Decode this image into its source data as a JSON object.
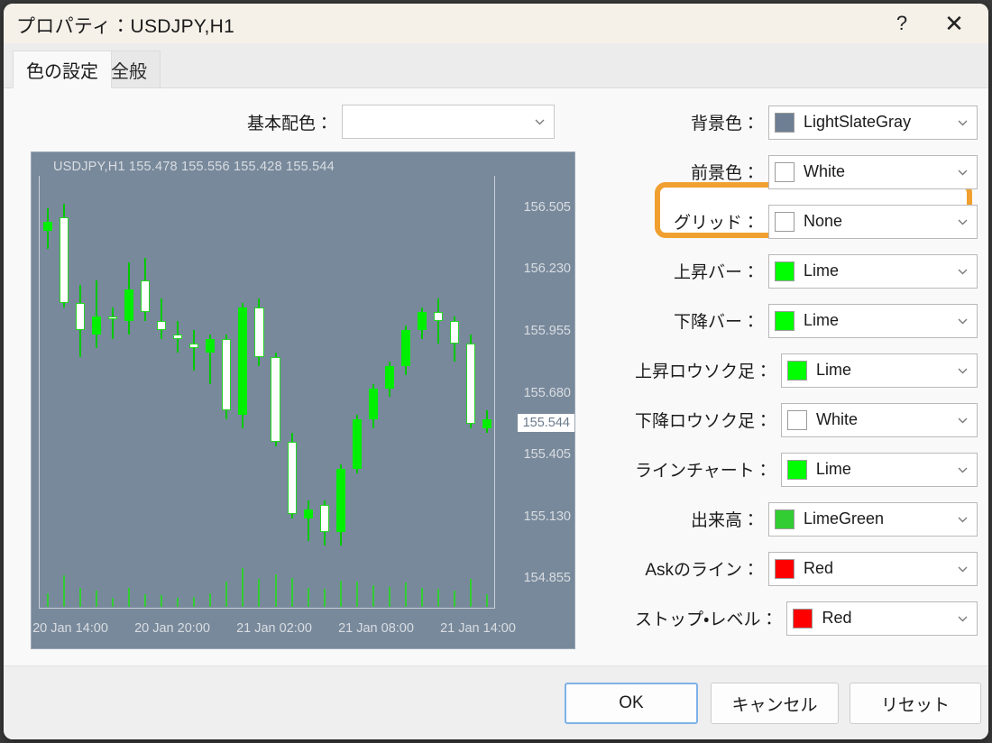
{
  "window": {
    "title": "プロパティ：USDJPY,H1",
    "help_icon": "question-mark-icon",
    "close_icon": "close-icon"
  },
  "tabs": [
    {
      "label": "色の設定",
      "active": true
    },
    {
      "label": "全般",
      "active": false
    }
  ],
  "scheme": {
    "label": "基本配色：",
    "value": "",
    "placeholder": ""
  },
  "settings": {
    "rows": [
      {
        "label": "背景色：",
        "value": "LightSlateGray",
        "color": "#6e7f94",
        "highlighted": true
      },
      {
        "label": "前景色：",
        "value": "White",
        "color": "#ffffff",
        "highlighted": false
      },
      {
        "label": "グリッド：",
        "value": "None",
        "color": "#ffffff",
        "highlighted": false
      },
      {
        "label": "上昇バー：",
        "value": "Lime",
        "color": "#00ff00",
        "highlighted": false
      },
      {
        "label": "下降バー：",
        "value": "Lime",
        "color": "#00ff00",
        "highlighted": false
      },
      {
        "label": "上昇ロウソク足：",
        "value": "Lime",
        "color": "#00ff00",
        "highlighted": false
      },
      {
        "label": "下降ロウソク足：",
        "value": "White",
        "color": "#ffffff",
        "highlighted": false
      },
      {
        "label": "ラインチャート：",
        "value": "Lime",
        "color": "#00ff00",
        "highlighted": false
      },
      {
        "label": "出来高：",
        "value": "LimeGreen",
        "color": "#32cd32",
        "highlighted": false
      },
      {
        "label": "Askのライン：",
        "value": "Red",
        "color": "#ff0000",
        "highlighted": false
      },
      {
        "label": "ストップ・レベル：",
        "value": "Red",
        "color": "#ff0000",
        "highlighted": false
      }
    ],
    "highlight_color": "#f0a030"
  },
  "footer": {
    "ok": "OK",
    "cancel": "キャンセル",
    "reset": "リセット"
  },
  "chart_data": {
    "type": "candlestick",
    "title": "USDJPY,H1  155.478 155.556 155.428 155.544",
    "symbol": "USDJPY",
    "timeframe": "H1",
    "ohlc": {
      "open": 155.478,
      "high": 155.556,
      "low": 155.428,
      "close": 155.544
    },
    "background_color": "#78899b",
    "up_color": "#00ff00",
    "down_color": "#ffffff",
    "volume_color": "#32cd32",
    "grid": false,
    "ylabel": "",
    "xlabel": "",
    "ylim": [
      154.72,
      156.64
    ],
    "y_ticks": [
      "156.505",
      "156.230",
      "155.955",
      "155.680",
      "155.405",
      "155.130",
      "154.855"
    ],
    "current_price_label": "155.544",
    "x_ticks": [
      "20 Jan 14:00",
      "20 Jan 20:00",
      "21 Jan 02:00",
      "21 Jan 08:00",
      "21 Jan 14:00"
    ],
    "candles": [
      {
        "o": 156.44,
        "h": 156.5,
        "l": 156.32,
        "c": 156.4,
        "dir": "up",
        "v": 0.22
      },
      {
        "o": 156.46,
        "h": 156.52,
        "l": 156.06,
        "c": 156.08,
        "dir": "down",
        "v": 0.5
      },
      {
        "o": 156.08,
        "h": 156.16,
        "l": 155.84,
        "c": 155.96,
        "dir": "down",
        "v": 0.3
      },
      {
        "o": 155.94,
        "h": 156.18,
        "l": 155.88,
        "c": 156.02,
        "dir": "up",
        "v": 0.26
      },
      {
        "o": 156.02,
        "h": 156.06,
        "l": 155.92,
        "c": 156.02,
        "dir": "down",
        "v": 0.15
      },
      {
        "o": 156.0,
        "h": 156.26,
        "l": 155.94,
        "c": 156.14,
        "dir": "up",
        "v": 0.3
      },
      {
        "o": 156.18,
        "h": 156.28,
        "l": 156.0,
        "c": 156.04,
        "dir": "down",
        "v": 0.2
      },
      {
        "o": 156.0,
        "h": 156.1,
        "l": 155.92,
        "c": 155.96,
        "dir": "down",
        "v": 0.18
      },
      {
        "o": 155.94,
        "h": 156.0,
        "l": 155.86,
        "c": 155.92,
        "dir": "down",
        "v": 0.14
      },
      {
        "o": 155.88,
        "h": 155.96,
        "l": 155.78,
        "c": 155.9,
        "dir": "down",
        "v": 0.16
      },
      {
        "o": 155.86,
        "h": 155.94,
        "l": 155.72,
        "c": 155.92,
        "dir": "up",
        "v": 0.22
      },
      {
        "o": 155.92,
        "h": 155.94,
        "l": 155.56,
        "c": 155.6,
        "dir": "down",
        "v": 0.4
      },
      {
        "o": 155.58,
        "h": 156.08,
        "l": 155.52,
        "c": 156.06,
        "dir": "up",
        "v": 0.62
      },
      {
        "o": 156.06,
        "h": 156.1,
        "l": 155.8,
        "c": 155.84,
        "dir": "down",
        "v": 0.44
      },
      {
        "o": 155.84,
        "h": 155.86,
        "l": 155.44,
        "c": 155.46,
        "dir": "down",
        "v": 0.52
      },
      {
        "o": 155.46,
        "h": 155.5,
        "l": 155.12,
        "c": 155.14,
        "dir": "down",
        "v": 0.46
      },
      {
        "o": 155.12,
        "h": 155.2,
        "l": 155.02,
        "c": 155.16,
        "dir": "up",
        "v": 0.3
      },
      {
        "o": 155.18,
        "h": 155.2,
        "l": 155.0,
        "c": 155.06,
        "dir": "down",
        "v": 0.28
      },
      {
        "o": 155.06,
        "h": 155.36,
        "l": 155.0,
        "c": 155.34,
        "dir": "up",
        "v": 0.42
      },
      {
        "o": 155.34,
        "h": 155.58,
        "l": 155.32,
        "c": 155.56,
        "dir": "up",
        "v": 0.4
      },
      {
        "o": 155.56,
        "h": 155.72,
        "l": 155.52,
        "c": 155.7,
        "dir": "up",
        "v": 0.34
      },
      {
        "o": 155.7,
        "h": 155.82,
        "l": 155.66,
        "c": 155.8,
        "dir": "up",
        "v": 0.32
      },
      {
        "o": 155.8,
        "h": 155.98,
        "l": 155.76,
        "c": 155.96,
        "dir": "up",
        "v": 0.38
      },
      {
        "o": 155.96,
        "h": 156.06,
        "l": 155.92,
        "c": 156.04,
        "dir": "up",
        "v": 0.3
      },
      {
        "o": 156.04,
        "h": 156.1,
        "l": 155.9,
        "c": 156.0,
        "dir": "down",
        "v": 0.28
      },
      {
        "o": 156.0,
        "h": 156.02,
        "l": 155.82,
        "c": 155.9,
        "dir": "down",
        "v": 0.26
      },
      {
        "o": 155.9,
        "h": 155.94,
        "l": 155.52,
        "c": 155.54,
        "dir": "down",
        "v": 0.44
      },
      {
        "o": 155.52,
        "h": 155.6,
        "l": 155.5,
        "c": 155.56,
        "dir": "up",
        "v": 0.2
      }
    ]
  }
}
